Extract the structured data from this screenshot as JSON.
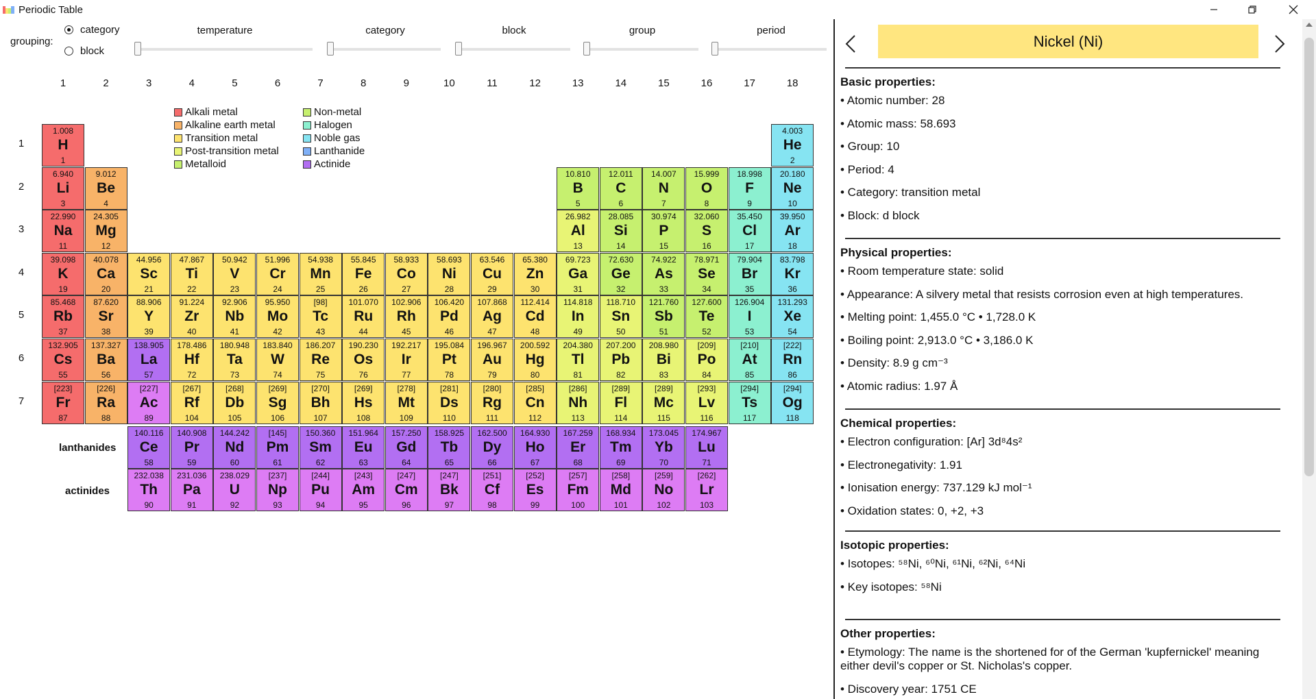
{
  "window": {
    "title": "Periodic Table"
  },
  "controls": {
    "grouping_label": "grouping:",
    "options": [
      {
        "label": "category",
        "selected": true
      },
      {
        "label": "block",
        "selected": false
      }
    ],
    "sliders": [
      {
        "label": "temperature"
      },
      {
        "label": "category"
      },
      {
        "label": "block"
      },
      {
        "label": "group"
      },
      {
        "label": "period"
      }
    ]
  },
  "group_numbers": [
    "1",
    "2",
    "3",
    "4",
    "5",
    "6",
    "7",
    "8",
    "9",
    "10",
    "11",
    "12",
    "13",
    "14",
    "15",
    "16",
    "17",
    "18"
  ],
  "period_numbers": [
    "1",
    "2",
    "3",
    "4",
    "5",
    "6",
    "7"
  ],
  "legend": [
    {
      "label": "Alkali metal",
      "color": "#f56c6c"
    },
    {
      "label": "Alkaline earth metal",
      "color": "#f8b368"
    },
    {
      "label": "Transition metal",
      "color": "#fde36f"
    },
    {
      "label": "Post-transition metal",
      "color": "#e8f475"
    },
    {
      "label": "Metalloid",
      "color": "#c6f06f"
    },
    {
      "label": "Non-metal",
      "color": "#c6f06f"
    },
    {
      "label": "Halogen",
      "color": "#8cf0d0"
    },
    {
      "label": "Noble gas",
      "color": "#86e4f2"
    },
    {
      "label": "Lanthanide",
      "color": "#7fb0f7"
    },
    {
      "label": "Actinide",
      "color": "#b26ff2"
    }
  ],
  "colors": {
    "alkali": "#f56c6c",
    "alkaline": "#f8b368",
    "transition": "#fde36f",
    "post": "#e8f475",
    "metalloid": "#c6f06f",
    "nonmetal": "#c6f06f",
    "halogen": "#8cf0d0",
    "noble": "#86e4f2",
    "lanthanide": "#b26ff2",
    "actinide": "#dd7cf4",
    "header": "#ffe680"
  },
  "elements": [
    {
      "sym": "H",
      "z": "1",
      "mass": "1.008",
      "group": 1,
      "period": 1,
      "cat": "alkali"
    },
    {
      "sym": "He",
      "z": "2",
      "mass": "4.003",
      "group": 18,
      "period": 1,
      "cat": "noble"
    },
    {
      "sym": "Li",
      "z": "3",
      "mass": "6.940",
      "group": 1,
      "period": 2,
      "cat": "alkali"
    },
    {
      "sym": "Be",
      "z": "4",
      "mass": "9.012",
      "group": 2,
      "period": 2,
      "cat": "alkaline"
    },
    {
      "sym": "B",
      "z": "5",
      "mass": "10.810",
      "group": 13,
      "period": 2,
      "cat": "metalloid"
    },
    {
      "sym": "C",
      "z": "6",
      "mass": "12.011",
      "group": 14,
      "period": 2,
      "cat": "nonmetal"
    },
    {
      "sym": "N",
      "z": "7",
      "mass": "14.007",
      "group": 15,
      "period": 2,
      "cat": "nonmetal"
    },
    {
      "sym": "O",
      "z": "8",
      "mass": "15.999",
      "group": 16,
      "period": 2,
      "cat": "nonmetal"
    },
    {
      "sym": "F",
      "z": "9",
      "mass": "18.998",
      "group": 17,
      "period": 2,
      "cat": "halogen"
    },
    {
      "sym": "Ne",
      "z": "10",
      "mass": "20.180",
      "group": 18,
      "period": 2,
      "cat": "noble"
    },
    {
      "sym": "Na",
      "z": "11",
      "mass": "22.990",
      "group": 1,
      "period": 3,
      "cat": "alkali"
    },
    {
      "sym": "Mg",
      "z": "12",
      "mass": "24.305",
      "group": 2,
      "period": 3,
      "cat": "alkaline"
    },
    {
      "sym": "Al",
      "z": "13",
      "mass": "26.982",
      "group": 13,
      "period": 3,
      "cat": "post"
    },
    {
      "sym": "Si",
      "z": "14",
      "mass": "28.085",
      "group": 14,
      "period": 3,
      "cat": "metalloid"
    },
    {
      "sym": "P",
      "z": "15",
      "mass": "30.974",
      "group": 15,
      "period": 3,
      "cat": "nonmetal"
    },
    {
      "sym": "S",
      "z": "16",
      "mass": "32.060",
      "group": 16,
      "period": 3,
      "cat": "nonmetal"
    },
    {
      "sym": "Cl",
      "z": "17",
      "mass": "35.450",
      "group": 17,
      "period": 3,
      "cat": "halogen"
    },
    {
      "sym": "Ar",
      "z": "18",
      "mass": "39.950",
      "group": 18,
      "period": 3,
      "cat": "noble"
    },
    {
      "sym": "K",
      "z": "19",
      "mass": "39.098",
      "group": 1,
      "period": 4,
      "cat": "alkali"
    },
    {
      "sym": "Ca",
      "z": "20",
      "mass": "40.078",
      "group": 2,
      "period": 4,
      "cat": "alkaline"
    },
    {
      "sym": "Sc",
      "z": "21",
      "mass": "44.956",
      "group": 3,
      "period": 4,
      "cat": "transition"
    },
    {
      "sym": "Ti",
      "z": "22",
      "mass": "47.867",
      "group": 4,
      "period": 4,
      "cat": "transition"
    },
    {
      "sym": "V",
      "z": "23",
      "mass": "50.942",
      "group": 5,
      "period": 4,
      "cat": "transition"
    },
    {
      "sym": "Cr",
      "z": "24",
      "mass": "51.996",
      "group": 6,
      "period": 4,
      "cat": "transition"
    },
    {
      "sym": "Mn",
      "z": "25",
      "mass": "54.938",
      "group": 7,
      "period": 4,
      "cat": "transition"
    },
    {
      "sym": "Fe",
      "z": "26",
      "mass": "55.845",
      "group": 8,
      "period": 4,
      "cat": "transition"
    },
    {
      "sym": "Co",
      "z": "27",
      "mass": "58.933",
      "group": 9,
      "period": 4,
      "cat": "transition"
    },
    {
      "sym": "Ni",
      "z": "28",
      "mass": "58.693",
      "group": 10,
      "period": 4,
      "cat": "transition"
    },
    {
      "sym": "Cu",
      "z": "29",
      "mass": "63.546",
      "group": 11,
      "period": 4,
      "cat": "transition"
    },
    {
      "sym": "Zn",
      "z": "30",
      "mass": "65.380",
      "group": 12,
      "period": 4,
      "cat": "transition"
    },
    {
      "sym": "Ga",
      "z": "31",
      "mass": "69.723",
      "group": 13,
      "period": 4,
      "cat": "post"
    },
    {
      "sym": "Ge",
      "z": "32",
      "mass": "72.630",
      "group": 14,
      "period": 4,
      "cat": "metalloid"
    },
    {
      "sym": "As",
      "z": "33",
      "mass": "74.922",
      "group": 15,
      "period": 4,
      "cat": "metalloid"
    },
    {
      "sym": "Se",
      "z": "34",
      "mass": "78.971",
      "group": 16,
      "period": 4,
      "cat": "nonmetal"
    },
    {
      "sym": "Br",
      "z": "35",
      "mass": "79.904",
      "group": 17,
      "period": 4,
      "cat": "halogen"
    },
    {
      "sym": "Kr",
      "z": "36",
      "mass": "83.798",
      "group": 18,
      "period": 4,
      "cat": "noble"
    },
    {
      "sym": "Rb",
      "z": "37",
      "mass": "85.468",
      "group": 1,
      "period": 5,
      "cat": "alkali"
    },
    {
      "sym": "Sr",
      "z": "38",
      "mass": "87.620",
      "group": 2,
      "period": 5,
      "cat": "alkaline"
    },
    {
      "sym": "Y",
      "z": "39",
      "mass": "88.906",
      "group": 3,
      "period": 5,
      "cat": "transition"
    },
    {
      "sym": "Zr",
      "z": "40",
      "mass": "91.224",
      "group": 4,
      "period": 5,
      "cat": "transition"
    },
    {
      "sym": "Nb",
      "z": "41",
      "mass": "92.906",
      "group": 5,
      "period": 5,
      "cat": "transition"
    },
    {
      "sym": "Mo",
      "z": "42",
      "mass": "95.950",
      "group": 6,
      "period": 5,
      "cat": "transition"
    },
    {
      "sym": "Tc",
      "z": "43",
      "mass": "[98]",
      "group": 7,
      "period": 5,
      "cat": "transition"
    },
    {
      "sym": "Ru",
      "z": "44",
      "mass": "101.070",
      "group": 8,
      "period": 5,
      "cat": "transition"
    },
    {
      "sym": "Rh",
      "z": "45",
      "mass": "102.906",
      "group": 9,
      "period": 5,
      "cat": "transition"
    },
    {
      "sym": "Pd",
      "z": "46",
      "mass": "106.420",
      "group": 10,
      "period": 5,
      "cat": "transition"
    },
    {
      "sym": "Ag",
      "z": "47",
      "mass": "107.868",
      "group": 11,
      "period": 5,
      "cat": "transition"
    },
    {
      "sym": "Cd",
      "z": "48",
      "mass": "112.414",
      "group": 12,
      "period": 5,
      "cat": "transition"
    },
    {
      "sym": "In",
      "z": "49",
      "mass": "114.818",
      "group": 13,
      "period": 5,
      "cat": "post"
    },
    {
      "sym": "Sn",
      "z": "50",
      "mass": "118.710",
      "group": 14,
      "period": 5,
      "cat": "post"
    },
    {
      "sym": "Sb",
      "z": "51",
      "mass": "121.760",
      "group": 15,
      "period": 5,
      "cat": "metalloid"
    },
    {
      "sym": "Te",
      "z": "52",
      "mass": "127.600",
      "group": 16,
      "period": 5,
      "cat": "metalloid"
    },
    {
      "sym": "I",
      "z": "53",
      "mass": "126.904",
      "group": 17,
      "period": 5,
      "cat": "halogen"
    },
    {
      "sym": "Xe",
      "z": "54",
      "mass": "131.293",
      "group": 18,
      "period": 5,
      "cat": "noble"
    },
    {
      "sym": "Cs",
      "z": "55",
      "mass": "132.905",
      "group": 1,
      "period": 6,
      "cat": "alkali"
    },
    {
      "sym": "Ba",
      "z": "56",
      "mass": "137.327",
      "group": 2,
      "period": 6,
      "cat": "alkaline"
    },
    {
      "sym": "La",
      "z": "57",
      "mass": "138.905",
      "group": 3,
      "period": 6,
      "cat": "lanthanide"
    },
    {
      "sym": "Hf",
      "z": "72",
      "mass": "178.486",
      "group": 4,
      "period": 6,
      "cat": "transition"
    },
    {
      "sym": "Ta",
      "z": "73",
      "mass": "180.948",
      "group": 5,
      "period": 6,
      "cat": "transition"
    },
    {
      "sym": "W",
      "z": "74",
      "mass": "183.840",
      "group": 6,
      "period": 6,
      "cat": "transition"
    },
    {
      "sym": "Re",
      "z": "75",
      "mass": "186.207",
      "group": 7,
      "period": 6,
      "cat": "transition"
    },
    {
      "sym": "Os",
      "z": "76",
      "mass": "190.230",
      "group": 8,
      "period": 6,
      "cat": "transition"
    },
    {
      "sym": "Ir",
      "z": "77",
      "mass": "192.217",
      "group": 9,
      "period": 6,
      "cat": "transition"
    },
    {
      "sym": "Pt",
      "z": "78",
      "mass": "195.084",
      "group": 10,
      "period": 6,
      "cat": "transition"
    },
    {
      "sym": "Au",
      "z": "79",
      "mass": "196.967",
      "group": 11,
      "period": 6,
      "cat": "transition"
    },
    {
      "sym": "Hg",
      "z": "80",
      "mass": "200.592",
      "group": 12,
      "period": 6,
      "cat": "transition"
    },
    {
      "sym": "Tl",
      "z": "81",
      "mass": "204.380",
      "group": 13,
      "period": 6,
      "cat": "post"
    },
    {
      "sym": "Pb",
      "z": "82",
      "mass": "207.200",
      "group": 14,
      "period": 6,
      "cat": "post"
    },
    {
      "sym": "Bi",
      "z": "83",
      "mass": "208.980",
      "group": 15,
      "period": 6,
      "cat": "post"
    },
    {
      "sym": "Po",
      "z": "84",
      "mass": "[209]",
      "group": 16,
      "period": 6,
      "cat": "post"
    },
    {
      "sym": "At",
      "z": "85",
      "mass": "[210]",
      "group": 17,
      "period": 6,
      "cat": "halogen"
    },
    {
      "sym": "Rn",
      "z": "86",
      "mass": "[222]",
      "group": 18,
      "period": 6,
      "cat": "noble"
    },
    {
      "sym": "Fr",
      "z": "87",
      "mass": "[223]",
      "group": 1,
      "period": 7,
      "cat": "alkali"
    },
    {
      "sym": "Ra",
      "z": "88",
      "mass": "[226]",
      "group": 2,
      "period": 7,
      "cat": "alkaline"
    },
    {
      "sym": "Ac",
      "z": "89",
      "mass": "[227]",
      "group": 3,
      "period": 7,
      "cat": "actinide"
    },
    {
      "sym": "Rf",
      "z": "104",
      "mass": "[267]",
      "group": 4,
      "period": 7,
      "cat": "transition"
    },
    {
      "sym": "Db",
      "z": "105",
      "mass": "[268]",
      "group": 5,
      "period": 7,
      "cat": "transition"
    },
    {
      "sym": "Sg",
      "z": "106",
      "mass": "[269]",
      "group": 6,
      "period": 7,
      "cat": "transition"
    },
    {
      "sym": "Bh",
      "z": "107",
      "mass": "[270]",
      "group": 7,
      "period": 7,
      "cat": "transition"
    },
    {
      "sym": "Hs",
      "z": "108",
      "mass": "[269]",
      "group": 8,
      "period": 7,
      "cat": "transition"
    },
    {
      "sym": "Mt",
      "z": "109",
      "mass": "[278]",
      "group": 9,
      "period": 7,
      "cat": "transition"
    },
    {
      "sym": "Ds",
      "z": "110",
      "mass": "[281]",
      "group": 10,
      "period": 7,
      "cat": "transition"
    },
    {
      "sym": "Rg",
      "z": "111",
      "mass": "[280]",
      "group": 11,
      "period": 7,
      "cat": "transition"
    },
    {
      "sym": "Cn",
      "z": "112",
      "mass": "[285]",
      "group": 12,
      "period": 7,
      "cat": "transition"
    },
    {
      "sym": "Nh",
      "z": "113",
      "mass": "[286]",
      "group": 13,
      "period": 7,
      "cat": "post"
    },
    {
      "sym": "Fl",
      "z": "114",
      "mass": "[289]",
      "group": 14,
      "period": 7,
      "cat": "post"
    },
    {
      "sym": "Mc",
      "z": "115",
      "mass": "[289]",
      "group": 15,
      "period": 7,
      "cat": "post"
    },
    {
      "sym": "Lv",
      "z": "116",
      "mass": "[293]",
      "group": 16,
      "period": 7,
      "cat": "post"
    },
    {
      "sym": "Ts",
      "z": "117",
      "mass": "[294]",
      "group": 17,
      "period": 7,
      "cat": "halogen"
    },
    {
      "sym": "Og",
      "z": "118",
      "mass": "[294]",
      "group": 18,
      "period": 7,
      "cat": "noble"
    }
  ],
  "f_block": {
    "lanthanides_label": "lanthanides",
    "actinides_label": "actinides",
    "lanthanides": [
      {
        "sym": "Ce",
        "z": "58",
        "mass": "140.116"
      },
      {
        "sym": "Pr",
        "z": "59",
        "mass": "140.908"
      },
      {
        "sym": "Nd",
        "z": "60",
        "mass": "144.242"
      },
      {
        "sym": "Pm",
        "z": "61",
        "mass": "[145]"
      },
      {
        "sym": "Sm",
        "z": "62",
        "mass": "150.360"
      },
      {
        "sym": "Eu",
        "z": "63",
        "mass": "151.964"
      },
      {
        "sym": "Gd",
        "z": "64",
        "mass": "157.250"
      },
      {
        "sym": "Tb",
        "z": "65",
        "mass": "158.925"
      },
      {
        "sym": "Dy",
        "z": "66",
        "mass": "162.500"
      },
      {
        "sym": "Ho",
        "z": "67",
        "mass": "164.930"
      },
      {
        "sym": "Er",
        "z": "68",
        "mass": "167.259"
      },
      {
        "sym": "Tm",
        "z": "69",
        "mass": "168.934"
      },
      {
        "sym": "Yb",
        "z": "70",
        "mass": "173.045"
      },
      {
        "sym": "Lu",
        "z": "71",
        "mass": "174.967"
      }
    ],
    "actinides": [
      {
        "sym": "Th",
        "z": "90",
        "mass": "232.038"
      },
      {
        "sym": "Pa",
        "z": "91",
        "mass": "231.036"
      },
      {
        "sym": "U",
        "z": "92",
        "mass": "238.029"
      },
      {
        "sym": "Np",
        "z": "93",
        "mass": "[237]"
      },
      {
        "sym": "Pu",
        "z": "94",
        "mass": "[244]"
      },
      {
        "sym": "Am",
        "z": "95",
        "mass": "[243]"
      },
      {
        "sym": "Cm",
        "z": "96",
        "mass": "[247]"
      },
      {
        "sym": "Bk",
        "z": "97",
        "mass": "[247]"
      },
      {
        "sym": "Cf",
        "z": "98",
        "mass": "[251]"
      },
      {
        "sym": "Es",
        "z": "99",
        "mass": "[252]"
      },
      {
        "sym": "Fm",
        "z": "100",
        "mass": "[257]"
      },
      {
        "sym": "Md",
        "z": "101",
        "mass": "[258]"
      },
      {
        "sym": "No",
        "z": "102",
        "mass": "[259]"
      },
      {
        "sym": "Lr",
        "z": "103",
        "mass": "[262]"
      }
    ]
  },
  "detail": {
    "title": "Nickel (Ni)",
    "sections": [
      {
        "title": "Basic properties:",
        "items": [
          "• Atomic number: 28",
          "• Atomic mass: 58.693",
          "• Group: 10",
          "• Period: 4",
          "• Category: transition metal",
          "• Block: d block"
        ]
      },
      {
        "title": "Physical properties:",
        "items": [
          "• Room temperature state: solid",
          "• Appearance: A silvery metal that resists corrosion even at high temperatures.",
          "• Melting point: 1,455.0 °C • 1,728.0 K",
          "• Boiling point: 2,913.0 °C • 3,186.0 K",
          "• Density: 8.9 g cm⁻³",
          "• Atomic radius: 1.97 Å"
        ]
      },
      {
        "title": "Chemical properties:",
        "items": [
          "• Electron configuration: [Ar] 3d⁸4s²",
          "• Electronegativity: 1.91",
          "• Ionisation energy: 737.129 kJ mol⁻¹",
          "• Oxidation states: 0, +2, +3"
        ]
      },
      {
        "title": "Isotopic properties:",
        "items": [
          "• Isotopes: ⁵⁸Ni, ⁶⁰Ni, ⁶¹Ni, ⁶²Ni, ⁶⁴Ni",
          "• Key isotopes: ⁵⁸Ni"
        ]
      },
      {
        "title": "Other properties:",
        "items": [
          "• Etymology: The name is the shortened for of the German 'kupfernickel' meaning either devil's copper or St. Nicholas's copper.",
          "• Discovery year: 1751 CE"
        ]
      }
    ]
  }
}
